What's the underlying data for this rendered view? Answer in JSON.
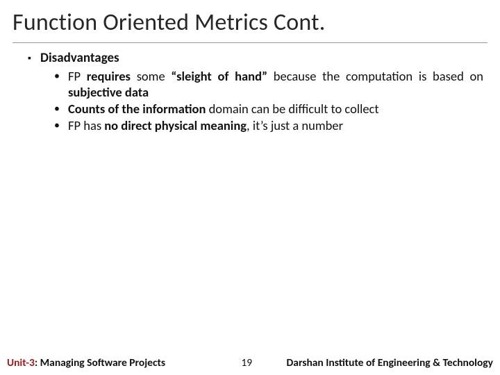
{
  "title": "Function Oriented Metrics Cont.",
  "heading": "Disadvantages",
  "bullets": {
    "b1_pre": "FP ",
    "b1_bold1": "requires",
    "b1_mid1": " some ",
    "b1_bold2": "“sleight of hand”",
    "b1_mid2": " because the computation is based on ",
    "b1_bold3": "subjective data",
    "b2_bold1": "Counts of the information",
    "b2_rest": " domain can be difficult to collect",
    "b3_pre": "FP has ",
    "b3_bold1": "no direct physical meaning",
    "b3_rest": ", it’s just a number"
  },
  "footer": {
    "unit_prefix": "Unit-3",
    "unit_rest": ": Managing Software Projects",
    "page": "19",
    "org": "Darshan Institute of Engineering & Technology"
  }
}
